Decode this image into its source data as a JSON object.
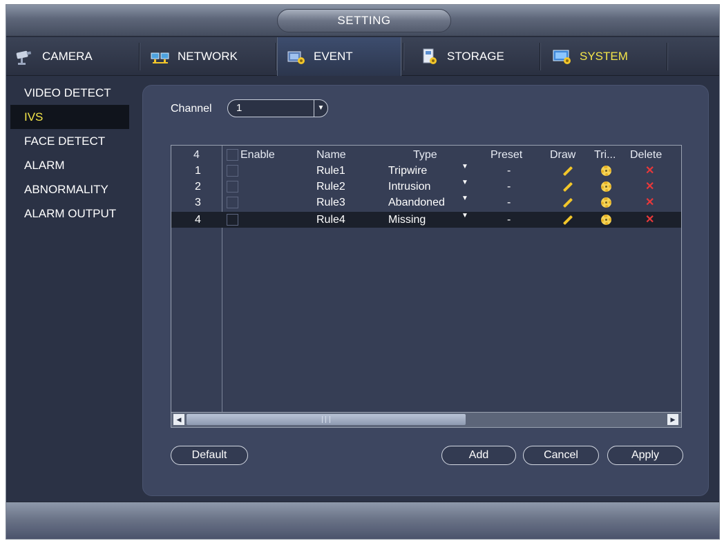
{
  "window": {
    "title": "SETTING"
  },
  "tabs": [
    {
      "label": "CAMERA",
      "icon": "camera-icon"
    },
    {
      "label": "NETWORK",
      "icon": "network-icon"
    },
    {
      "label": "EVENT",
      "icon": "event-icon",
      "active": true
    },
    {
      "label": "STORAGE",
      "icon": "storage-icon"
    },
    {
      "label": "SYSTEM",
      "icon": "system-icon"
    }
  ],
  "sidebar": {
    "items": [
      {
        "label": "VIDEO DETECT"
      },
      {
        "label": "IVS",
        "active": true
      },
      {
        "label": "FACE DETECT"
      },
      {
        "label": "ALARM"
      },
      {
        "label": "ABNORMALITY"
      },
      {
        "label": "ALARM OUTPUT"
      }
    ]
  },
  "channel": {
    "label": "Channel",
    "value": "1"
  },
  "table": {
    "headers": {
      "count": "4",
      "enable": "Enable",
      "name": "Name",
      "type": "Type",
      "preset": "Preset",
      "draw": "Draw",
      "trigger": "Tri...",
      "delete": "Delete"
    },
    "rows": [
      {
        "num": "1",
        "name": "Rule1",
        "type": "Tripwire",
        "preset": "-"
      },
      {
        "num": "2",
        "name": "Rule2",
        "type": "Intrusion",
        "preset": "-"
      },
      {
        "num": "3",
        "name": "Rule3",
        "type": "Abandoned",
        "preset": "-"
      },
      {
        "num": "4",
        "name": "Rule4",
        "type": "Missing",
        "preset": "-"
      }
    ]
  },
  "buttons": {
    "default": "Default",
    "add": "Add",
    "cancel": "Cancel",
    "apply": "Apply"
  },
  "colors": {
    "accent_yellow": "#f4e64a",
    "delete_red": "#e8383a",
    "panel_bg": "#3d4660"
  }
}
